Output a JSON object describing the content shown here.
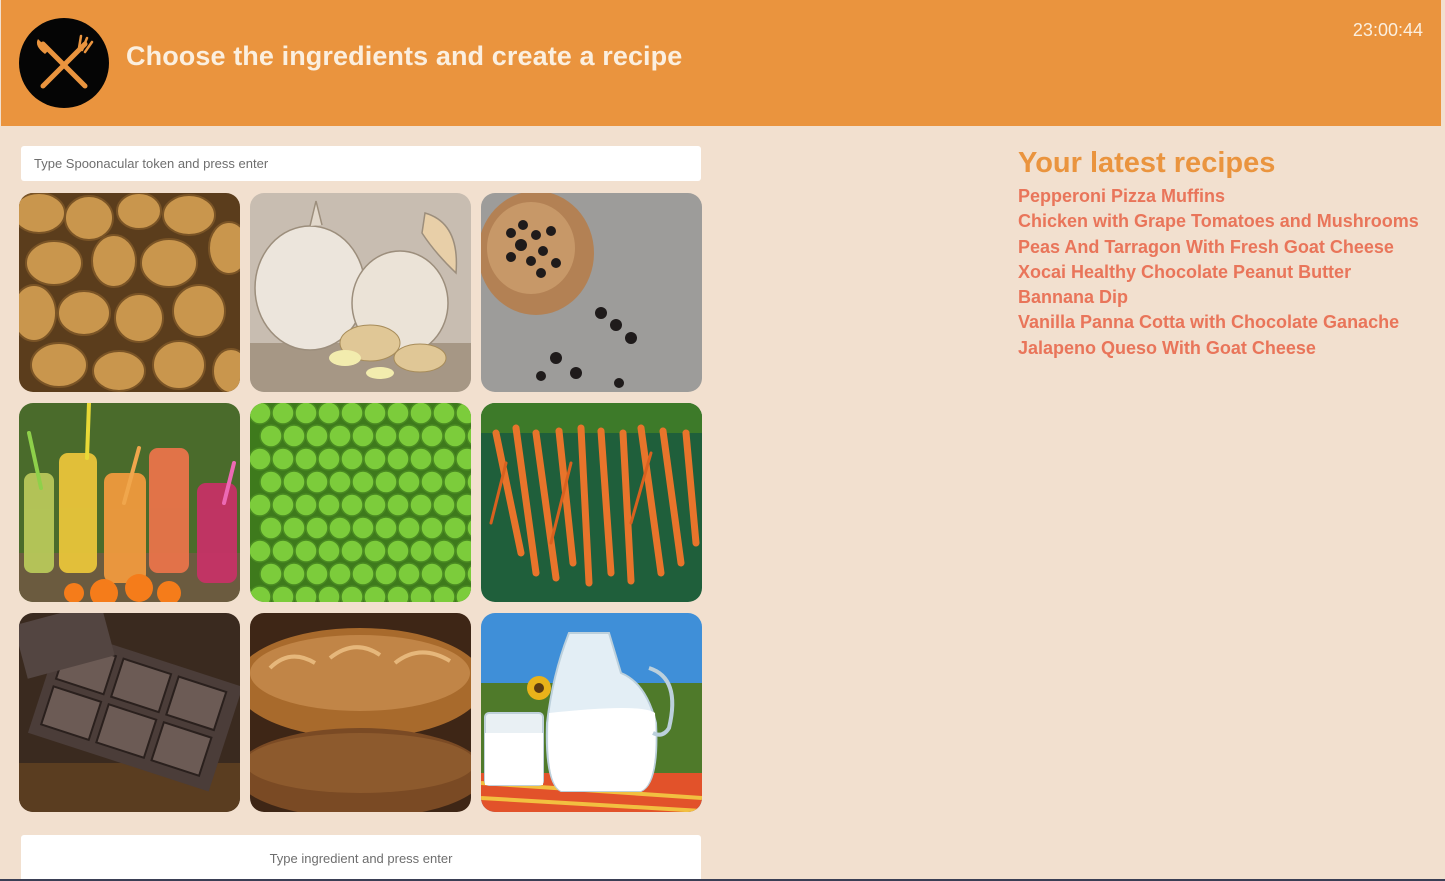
{
  "header": {
    "title": "Choose the ingredients and create a recipe",
    "clock": "23:00:44",
    "color": "#ea943e",
    "logo_icon": "fork-knife-icon"
  },
  "token_input": {
    "placeholder": "Type Spoonacular token and press enter",
    "value": ""
  },
  "ingredients": [
    {
      "name": "potatoes",
      "icon": "potatoes-image"
    },
    {
      "name": "garlic",
      "icon": "garlic-image"
    },
    {
      "name": "pepper",
      "icon": "peppercorn-image"
    },
    {
      "name": "juice",
      "icon": "juice-image"
    },
    {
      "name": "peas",
      "icon": "peas-image"
    },
    {
      "name": "carrots",
      "icon": "carrots-image"
    },
    {
      "name": "chocolate",
      "icon": "chocolate-image"
    },
    {
      "name": "bread",
      "icon": "bread-image"
    },
    {
      "name": "milk",
      "icon": "milk-image"
    }
  ],
  "ingredient_input": {
    "placeholder": "Type ingredient and press enter",
    "value": ""
  },
  "recipes": {
    "heading": "Your latest recipes",
    "items": [
      "Pepperoni Pizza Muffins",
      "Chicken with Grape Tomatoes and Mushrooms",
      "Peas And Tarragon With Fresh Goat Cheese",
      "Xocai Healthy Chocolate Peanut Butter Bannana Dip",
      "Vanilla Panna Cotta with Chocolate Ganache",
      "Jalapeno Queso With Goat Cheese"
    ],
    "heading_color": "#ea943e",
    "item_color": "#e9755a"
  }
}
